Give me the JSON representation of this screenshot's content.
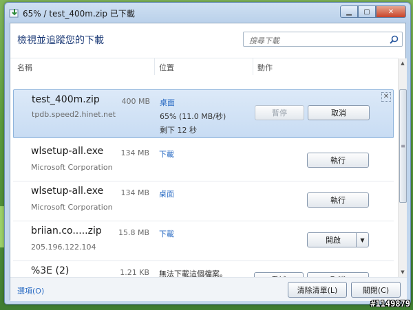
{
  "window": {
    "title": "65% / test_400m.zip 已下載"
  },
  "header": {
    "heading": "檢視並追蹤您的下載",
    "search_placeholder": "搜尋下載"
  },
  "columns": {
    "name": "名稱",
    "location": "位置",
    "actions": "動作"
  },
  "downloads": [
    {
      "name": "test_400m.zip",
      "source": "tpdb.speed2.hinet.net",
      "size": "400 MB",
      "location": "桌面",
      "progress_text": "65% (11.0 MB/秒)",
      "remaining": "剩下  12 秒",
      "progress": 0.65,
      "buttons": [
        "暫停",
        "取消"
      ],
      "selected": true
    },
    {
      "name": "wlsetup-all.exe",
      "source": "Microsoft Corporation",
      "size": "134 MB",
      "location": "下載",
      "buttons": [
        "執行"
      ]
    },
    {
      "name": "wlsetup-all.exe",
      "source": "Microsoft Corporation",
      "size": "134 MB",
      "location": "桌面",
      "buttons": [
        "執行"
      ]
    },
    {
      "name": "briian.co.....zip",
      "source": "205.196.122.104",
      "size": "15.8 MB",
      "location": "下載",
      "buttons": [
        "開啟"
      ]
    },
    {
      "name": "%3E (2)",
      "source": "",
      "size": "1.21 KB",
      "status": "無法下載這個檔案。",
      "buttons": [
        "重試",
        "取消"
      ]
    }
  ],
  "footer": {
    "options": "選項(O)",
    "clear_list": "清除清單(L)",
    "close": "關閉(C)"
  },
  "watermark": "#1149879",
  "colors": {
    "accent_link": "#2b6cc4",
    "selected_row": "#c8dcf3",
    "title_text": "#1e3c78"
  }
}
